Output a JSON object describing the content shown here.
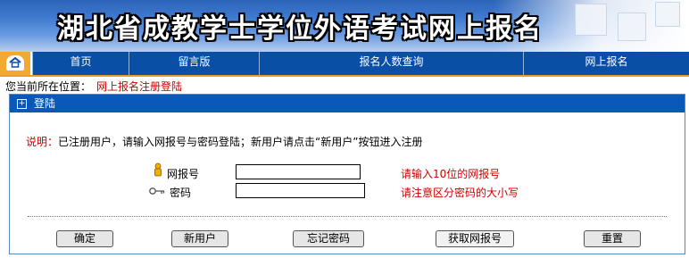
{
  "banner": {
    "title": "湖北省成教学士学位外语考试网上报名"
  },
  "nav": {
    "home_icon": "home-icon",
    "items": [
      {
        "label": "首页"
      },
      {
        "label": "留言版"
      },
      {
        "label": "报名人数查询"
      },
      {
        "label": "网上报名"
      }
    ]
  },
  "location": {
    "prefix": "您当前所在位置：",
    "current": "网上报名注册登陆"
  },
  "panel": {
    "title": "登陆",
    "desc_label": "说明：",
    "desc_text": "已注册用户，请输入网报号与密码登陆；新用户请点击“新用户”按钮进入注册",
    "fields": {
      "id_label": "网报号",
      "id_value": "",
      "id_hint": "请输入10位的网报号",
      "pwd_label": "密码",
      "pwd_value": "",
      "pwd_hint": "请注意区分密码的大小写"
    },
    "buttons": {
      "confirm": "确定",
      "new_user": "新用户",
      "forgot": "忘记密码",
      "get_id": "获取网报号",
      "reset": "重置"
    }
  },
  "colors": {
    "nav_bg": "#0a4fa6",
    "home_bg": "#f2a930",
    "hint": "#cc0000",
    "panel_head": "#0a58b8"
  }
}
